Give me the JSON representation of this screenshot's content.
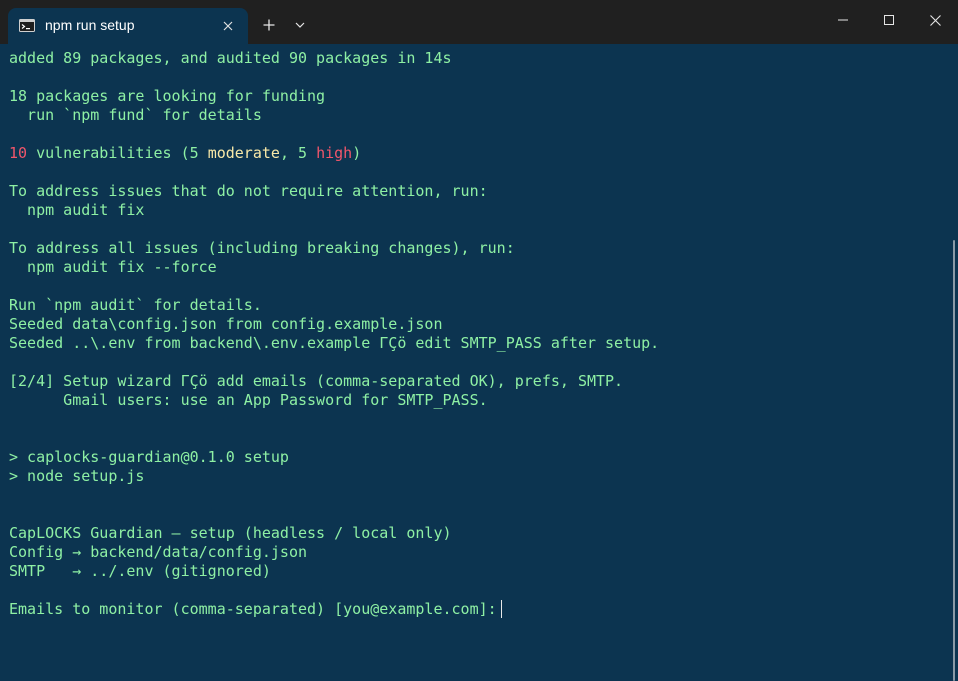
{
  "tab": {
    "title": "npm run setup",
    "icon": "terminal-icon"
  },
  "titlebar": {
    "new_tab_icon": "plus-icon",
    "dropdown_icon": "chevron-down-icon",
    "minimize_icon": "minimize-icon",
    "maximize_icon": "maximize-icon",
    "close_icon": "close-icon"
  },
  "colors": {
    "terminal_bg": "#0c3450",
    "text": "#8ef0a4",
    "red": "#f1566b",
    "yellow": "#f9e9a8",
    "titlebar_bg": "#202020"
  },
  "terminal": {
    "line1": "added 89 packages, and audited 90 packages in 14s",
    "line3": "18 packages are looking for funding",
    "line4": "  run `npm fund` for details",
    "vuln_count": "10",
    "vuln_text1": " vulnerabilities (5 ",
    "vuln_moderate": "moderate",
    "vuln_text2": ", 5 ",
    "vuln_high": "high",
    "vuln_text3": ")",
    "line8": "To address issues that do not require attention, run:",
    "line9": "  npm audit fix",
    "line11": "To address all issues (including breaking changes), run:",
    "line12": "  npm audit fix --force",
    "line14": "Run `npm audit` for details.",
    "line15": "Seeded data\\config.json from config.example.json",
    "line16": "Seeded ..\\.env from backend\\.env.example ΓÇö edit SMTP_PASS after setup.",
    "line18": "[2/4] Setup wizard ΓÇö add emails (comma-separated OK), prefs, SMTP.",
    "line19": "      Gmail users: use an App Password for SMTP_PASS.",
    "line22": "> caplocks-guardian@0.1.0 setup",
    "line23": "> node setup.js",
    "line26": "CapLOCKS Guardian — setup (headless / local only)",
    "line27": "Config → backend/data/config.json",
    "line28": "SMTP   → ../.env (gitignored)",
    "prompt": "Emails to monitor (comma-separated) [you@example.com]:"
  }
}
